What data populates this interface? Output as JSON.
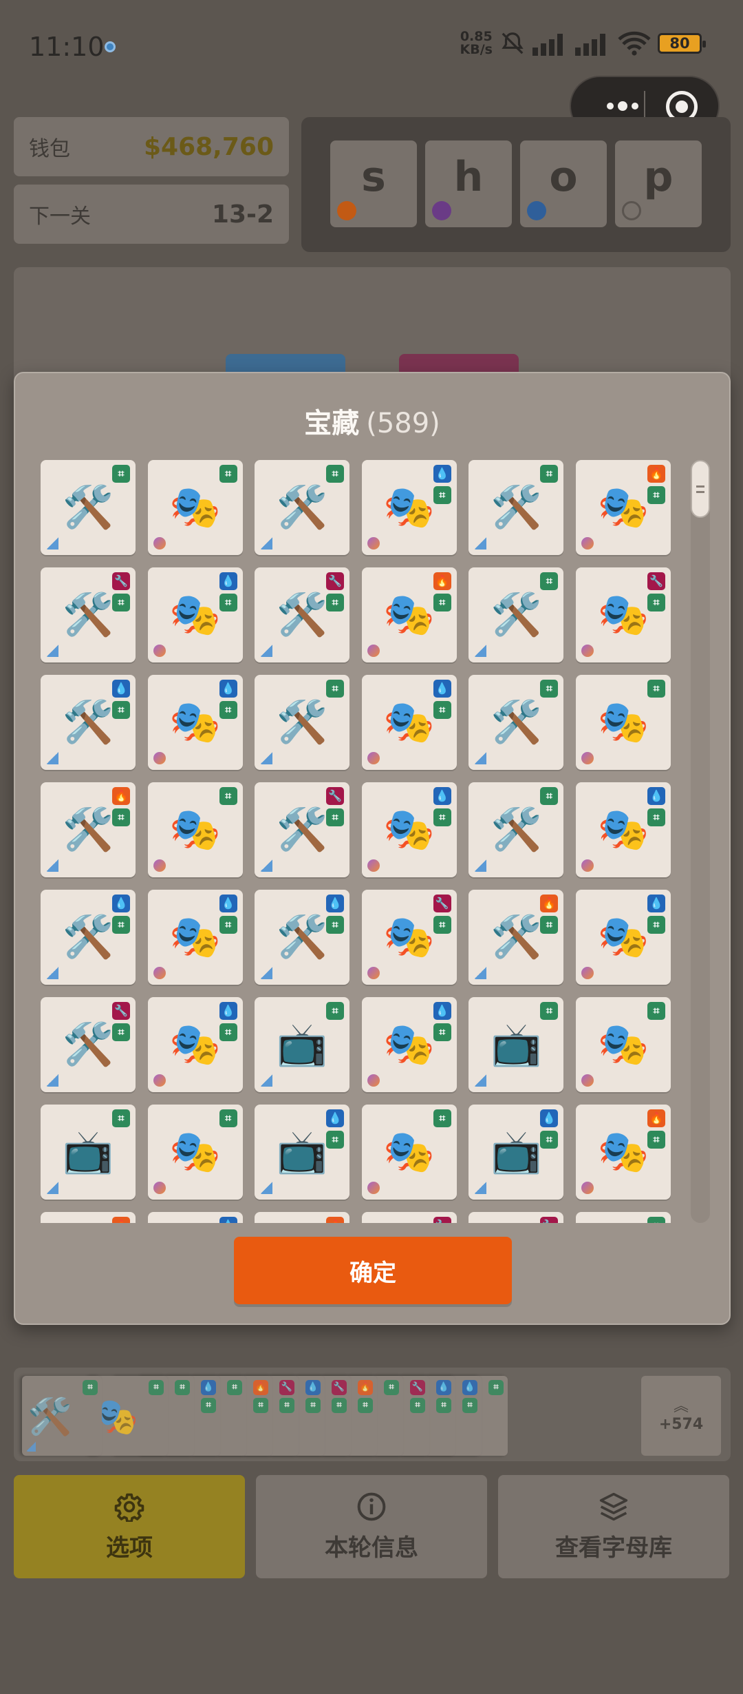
{
  "status_bar": {
    "time": "11:10",
    "net_speed_value": "0.85",
    "net_speed_unit": "KB/s",
    "battery": "80"
  },
  "top": {
    "wallet": {
      "label": "钱包",
      "value": "$468,760"
    },
    "level": {
      "label": "下一关",
      "value": "13-2"
    },
    "shop": [
      {
        "letter": "s",
        "dot_color": "#c25a14"
      },
      {
        "letter": "h",
        "dot_color": "#6a3b86"
      },
      {
        "letter": "o",
        "dot_color": "#2f5f9a"
      },
      {
        "letter": "p",
        "dot_color": "transparent"
      }
    ]
  },
  "modal": {
    "title": "宝藏",
    "count": "(589)",
    "confirm_label": "确定",
    "items": [
      {
        "icon": "🛠️",
        "type": "tool",
        "badges": [
          "green"
        ]
      },
      {
        "icon": "🎭",
        "type": "drama",
        "badges": [
          "green"
        ]
      },
      {
        "icon": "🛠️",
        "type": "tool",
        "badges": [
          "green"
        ]
      },
      {
        "icon": "🎭",
        "type": "drama",
        "badges": [
          "blue",
          "green"
        ]
      },
      {
        "icon": "🛠️",
        "type": "tool",
        "badges": [
          "green"
        ]
      },
      {
        "icon": "🎭",
        "type": "drama",
        "badges": [
          "orange",
          "green"
        ]
      },
      {
        "icon": "🛠️",
        "type": "tool",
        "badges": [
          "crimson",
          "green"
        ]
      },
      {
        "icon": "🎭",
        "type": "drama",
        "badges": [
          "blue",
          "green"
        ]
      },
      {
        "icon": "🛠️",
        "type": "tool",
        "badges": [
          "crimson",
          "green"
        ]
      },
      {
        "icon": "🎭",
        "type": "drama",
        "badges": [
          "orange",
          "green"
        ]
      },
      {
        "icon": "🛠️",
        "type": "tool",
        "badges": [
          "green"
        ]
      },
      {
        "icon": "🎭",
        "type": "drama",
        "badges": [
          "crimson",
          "green"
        ]
      },
      {
        "icon": "🛠️",
        "type": "tool",
        "badges": [
          "blue",
          "green"
        ]
      },
      {
        "icon": "🎭",
        "type": "drama",
        "badges": [
          "blue",
          "green"
        ]
      },
      {
        "icon": "🛠️",
        "type": "tool",
        "badges": [
          "green"
        ]
      },
      {
        "icon": "🎭",
        "type": "drama",
        "badges": [
          "blue",
          "green"
        ]
      },
      {
        "icon": "🛠️",
        "type": "tool",
        "badges": [
          "green"
        ]
      },
      {
        "icon": "🎭",
        "type": "drama",
        "badges": [
          "green"
        ]
      },
      {
        "icon": "🛠️",
        "type": "tool",
        "badges": [
          "orange",
          "green"
        ]
      },
      {
        "icon": "🎭",
        "type": "drama",
        "badges": [
          "green"
        ]
      },
      {
        "icon": "🛠️",
        "type": "tool",
        "badges": [
          "crimson",
          "green"
        ]
      },
      {
        "icon": "🎭",
        "type": "drama",
        "badges": [
          "blue",
          "green"
        ]
      },
      {
        "icon": "🛠️",
        "type": "tool",
        "badges": [
          "green"
        ]
      },
      {
        "icon": "🎭",
        "type": "drama",
        "badges": [
          "blue",
          "green"
        ]
      },
      {
        "icon": "🛠️",
        "type": "tool",
        "badges": [
          "blue",
          "green"
        ]
      },
      {
        "icon": "🎭",
        "type": "drama",
        "badges": [
          "blue",
          "green"
        ]
      },
      {
        "icon": "🛠️",
        "type": "tool",
        "badges": [
          "blue",
          "green"
        ]
      },
      {
        "icon": "🎭",
        "type": "drama",
        "badges": [
          "crimson",
          "green"
        ]
      },
      {
        "icon": "🛠️",
        "type": "tool",
        "badges": [
          "orange",
          "green"
        ]
      },
      {
        "icon": "🎭",
        "type": "drama",
        "badges": [
          "blue",
          "green"
        ]
      },
      {
        "icon": "🛠️",
        "type": "tool",
        "badges": [
          "crimson",
          "green"
        ]
      },
      {
        "icon": "🎭",
        "type": "drama",
        "badges": [
          "blue",
          "green"
        ]
      },
      {
        "icon": "📺",
        "type": "tool",
        "badges": [
          "green"
        ]
      },
      {
        "icon": "🎭",
        "type": "drama",
        "badges": [
          "blue",
          "green"
        ]
      },
      {
        "icon": "📺",
        "type": "tool",
        "badges": [
          "green"
        ]
      },
      {
        "icon": "🎭",
        "type": "drama",
        "badges": [
          "green"
        ]
      },
      {
        "icon": "📺",
        "type": "tool",
        "badges": [
          "green"
        ]
      },
      {
        "icon": "🎭",
        "type": "drama",
        "badges": [
          "green"
        ]
      },
      {
        "icon": "📺",
        "type": "tool",
        "badges": [
          "blue",
          "green"
        ]
      },
      {
        "icon": "🎭",
        "type": "drama",
        "badges": [
          "green"
        ]
      },
      {
        "icon": "📺",
        "type": "tool",
        "badges": [
          "blue",
          "green"
        ]
      },
      {
        "icon": "🎭",
        "type": "drama",
        "badges": [
          "orange",
          "green"
        ]
      },
      {
        "icon": "",
        "type": "tool",
        "badges": [
          "orange"
        ]
      },
      {
        "icon": "",
        "type": "drama",
        "badges": [
          "blue"
        ]
      },
      {
        "icon": "",
        "type": "tool",
        "badges": [
          "orange"
        ]
      },
      {
        "icon": "",
        "type": "drama",
        "badges": [
          "crimson"
        ]
      },
      {
        "icon": "",
        "type": "tool",
        "badges": [
          "crimson"
        ]
      },
      {
        "icon": "",
        "type": "drama",
        "badges": [
          "green"
        ]
      }
    ]
  },
  "hand": {
    "cards": [
      {
        "icon": "🛠️",
        "type": "tool",
        "badges": [
          "green"
        ]
      },
      {
        "icon": "🎭",
        "type": "drama",
        "badges": [
          "green"
        ]
      },
      {
        "icon": "🛠️",
        "type": "tool",
        "badges": [
          "green"
        ]
      },
      {
        "icon": "🎭",
        "type": "drama",
        "badges": [
          "blue",
          "green"
        ]
      },
      {
        "icon": "🛠️",
        "type": "tool",
        "badges": [
          "green"
        ]
      },
      {
        "icon": "🎭",
        "type": "drama",
        "badges": [
          "orange",
          "green"
        ]
      },
      {
        "icon": "🛠️",
        "type": "tool",
        "badges": [
          "crimson",
          "green"
        ]
      },
      {
        "icon": "🎭",
        "type": "drama",
        "badges": [
          "blue",
          "green"
        ]
      },
      {
        "icon": "🛠️",
        "type": "tool",
        "badges": [
          "crimson",
          "green"
        ]
      },
      {
        "icon": "🎭",
        "type": "drama",
        "badges": [
          "orange",
          "green"
        ]
      },
      {
        "icon": "🛠️",
        "type": "tool",
        "badges": [
          "green"
        ]
      },
      {
        "icon": "🎭",
        "type": "drama",
        "badges": [
          "crimson",
          "green"
        ]
      },
      {
        "icon": "🛠️",
        "type": "tool",
        "badges": [
          "blue",
          "green"
        ]
      },
      {
        "icon": "🎭",
        "type": "drama",
        "badges": [
          "blue",
          "green"
        ]
      },
      {
        "icon": "🛠️",
        "type": "tool",
        "badges": [
          "green"
        ]
      }
    ],
    "more_count": "+574"
  },
  "buttons": {
    "options": "选项",
    "round_info": "本轮信息",
    "letter_library": "查看字母库"
  },
  "colors": {
    "confirm": "#e95a10",
    "badge_green": "#2e8a5a",
    "badge_blue": "#2266b8",
    "badge_orange": "#e95a1d",
    "badge_crimson": "#a3174a",
    "options_button": "#958222"
  }
}
